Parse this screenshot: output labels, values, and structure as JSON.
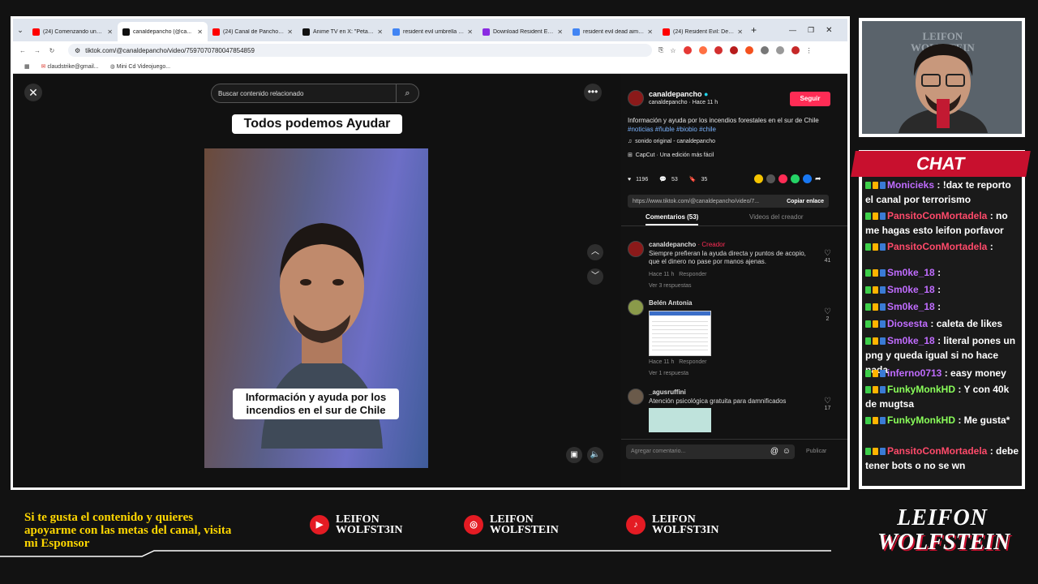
{
  "browser": {
    "tabs": [
      {
        "title": "(24) Comenzando una su...",
        "icon": "youtube-icon",
        "color": "#ff0000"
      },
      {
        "title": "canaldepancho (@ca...",
        "icon": "tiktok-icon",
        "color": "#111111"
      },
      {
        "title": "(24) Canal de Pancho Re...",
        "icon": "youtube-icon",
        "color": "#ff0000"
      },
      {
        "title": "Anime TV en X: \"Petals of...",
        "icon": "x-icon",
        "color": "#111111"
      },
      {
        "title": "resident evil umbrella chr...",
        "icon": "google-icon",
        "color": "#4285f4"
      },
      {
        "title": "Download Resident Evil...",
        "icon": "site-icon",
        "color": "#8a2be2"
      },
      {
        "title": "resident evil dead aim pc...",
        "icon": "google-icon",
        "color": "#4285f4"
      },
      {
        "title": "(24) Resident Evil: Dead A...",
        "icon": "youtube-icon",
        "color": "#ff0000"
      }
    ],
    "url": "tiktok.com/@canaldepancho/video/7597070780047854859",
    "bookmarks": [
      "claudstrike@gmail...",
      "Mini Cd Videojuego..."
    ]
  },
  "viewer": {
    "search_placeholder": "Buscar contenido relacionado",
    "caption_top": "Todos podemos Ayudar",
    "caption_bottom": "Información y ayuda por los incendios en el sur de Chile"
  },
  "panel": {
    "author": "canaldepancho",
    "author_sub": "canaldepancho · Hace 11 h",
    "follow_label": "Seguir",
    "description": "Información y ayuda por los incendios forestales en el sur de Chile",
    "hashtags": "#noticias #ñuble #biobio #chile",
    "sound": "sonido original - canaldepancho",
    "capcut": "CapCut · Una edición más fácil",
    "likes": "1196",
    "comments": "53",
    "saves": "35",
    "link": "https://www.tiktok.com/@canaldepancho/video/7...",
    "copy_label": "Copiar enlace",
    "tab_comments": "Comentarios (53)",
    "tab_videos": "Videos del creador",
    "comment_list": [
      {
        "user": "canaldepancho",
        "badge": "· Creador",
        "text": "Siempre prefieran la ayuda directa y puntos de acopio, que el dinero no pase por manos ajenas.",
        "time": "Hace 11 h",
        "reply": "Responder",
        "more": "Ver 3 respuestas",
        "likes": "41"
      },
      {
        "user": "Belén Antonia",
        "badge": "",
        "text": "",
        "time": "Hace 11 h",
        "reply": "Responder",
        "more": "Ver 1 respuesta",
        "likes": "2"
      },
      {
        "user": "_agusruffini",
        "badge": "",
        "text": "Atención psicológica gratuita para damnificados",
        "time": "",
        "reply": "",
        "more": "",
        "likes": "17"
      }
    ],
    "composer_placeholder": "Agregar comentario...",
    "publish_label": "Publicar"
  },
  "chat": {
    "header": "CHAT",
    "messages": [
      {
        "user": "Monicieks",
        "text": ": !dax te reporto el canal por terrorismo",
        "cls": "uname-p"
      },
      {
        "user": "PansitoConMortadela",
        "text": ": no me hagas esto leifon porfavor",
        "cls": "uname-r"
      },
      {
        "user": "PansitoConMortadela",
        "text": ":",
        "cls": "uname-r"
      },
      {
        "user": "Sm0ke_18",
        "text": ":",
        "cls": "uname-p"
      },
      {
        "user": "Sm0ke_18",
        "text": ":",
        "cls": "uname-p"
      },
      {
        "user": "Sm0ke_18",
        "text": ":",
        "cls": "uname-p"
      },
      {
        "user": "Diosesta",
        "text": ": caleta de likes",
        "cls": "uname-p"
      },
      {
        "user": "Sm0ke_18",
        "text": ": literal pones un png y queda igual si no hace nada",
        "cls": "uname-p"
      },
      {
        "user": "inferno0713",
        "text": ": easy money",
        "cls": "uname-p"
      },
      {
        "user": "FunkyMonkHD",
        "text": ": Y con 40k de mugtsa",
        "cls": "uname-g"
      },
      {
        "user": "FunkyMonkHD",
        "text": ": Me gusta*",
        "cls": "uname-g"
      },
      {
        "user": "PansitoConMortadela",
        "text": ": debe tener bots o no se wn",
        "cls": "uname-r"
      }
    ]
  },
  "overlay": {
    "promo": "Si te gusta el contenido y quieres apoyarme con las metas del canal, visita mi Esponsor",
    "socials": [
      {
        "line1": "LEIFON",
        "line2": "WOLFST3IN",
        "icon": "youtube-icon"
      },
      {
        "line1": "LEIFON",
        "line2": "WOLFSTEIN",
        "icon": "instagram-icon"
      },
      {
        "line1": "LEIFON",
        "line2": "WOLFST3IN",
        "icon": "tiktok-icon"
      }
    ],
    "logo_line1": "LEIFON",
    "logo_line2": "WOLFSTEIN",
    "cam_watermark1": "LEIFON",
    "cam_watermark2": "WOLFSTEIN"
  }
}
